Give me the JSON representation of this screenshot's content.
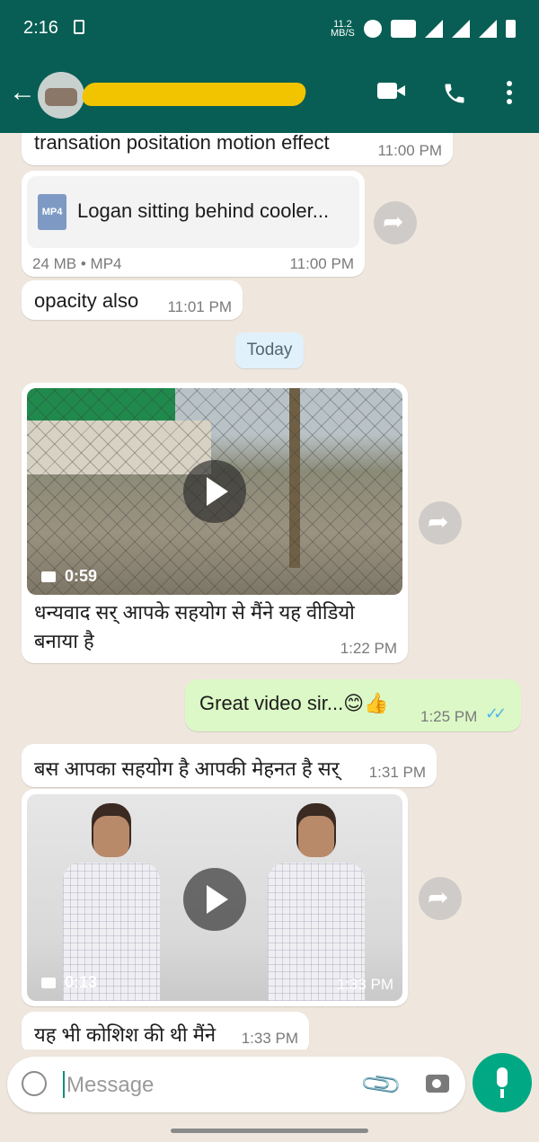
{
  "status_bar": {
    "time": "2:16",
    "speed_value": "11.2",
    "speed_unit": "MB/S"
  },
  "header": {
    "back_icon": "←"
  },
  "messages": {
    "m1": {
      "text": "transation positation motion effect",
      "time": "11:00 PM"
    },
    "m2": {
      "file_name": "Logan sitting  behind cooler...",
      "file_type_badge": "MP4",
      "file_meta": "24 MB • MP4",
      "time": "11:00 PM"
    },
    "m3": {
      "text": "opacity also",
      "time": "11:01 PM"
    },
    "day_divider": "Today",
    "m4": {
      "video_duration": "0:59",
      "caption": "धन्यवाद सर् आपके सहयोग से मैंने यह वीडियो बनाया है",
      "time": "1:22 PM"
    },
    "m5": {
      "text": "Great video sir...😊👍",
      "time": "1:25 PM",
      "status": "read",
      "tick_icon": "✓✓"
    },
    "m6": {
      "text": "बस आपका सहयोग है आपकी मेहनत है सर्",
      "time": "1:31 PM"
    },
    "m7": {
      "video_duration": "0:13",
      "time": "1:33 PM"
    },
    "m8": {
      "text": "यह भी कोशिश की थी मैंने",
      "time": "1:33 PM"
    }
  },
  "input": {
    "placeholder": "Message"
  },
  "colors": {
    "header": "#085e54",
    "outgoing_bubble": "#dcf8c6",
    "mic_button": "#00a884",
    "read_ticks": "#4fb6ec"
  }
}
